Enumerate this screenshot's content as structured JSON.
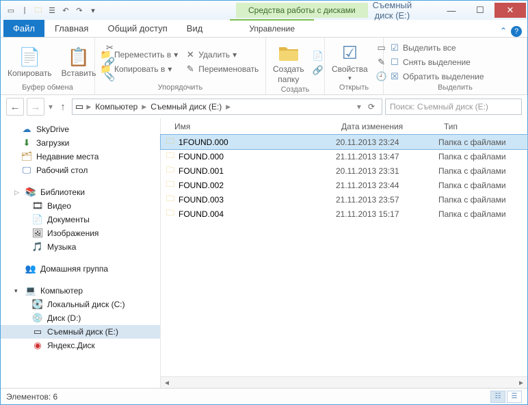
{
  "titlebar": {
    "context_tab": "Средства работы с дисками",
    "window_title": "Съемный диск (E:)"
  },
  "tabs": {
    "file": "Файл",
    "home": "Главная",
    "share": "Общий доступ",
    "view": "Вид",
    "manage": "Управление"
  },
  "ribbon": {
    "clipboard": {
      "copy": "Копировать",
      "paste": "Вставить",
      "label": "Буфер обмена"
    },
    "organize": {
      "moveto": "Переместить в",
      "copyto": "Копировать в",
      "delete": "Удалить",
      "rename": "Переименовать",
      "label": "Упорядочить"
    },
    "new": {
      "newfolder_l1": "Создать",
      "newfolder_l2": "папку",
      "label": "Создать"
    },
    "open": {
      "props": "Свойства",
      "label": "Открыть"
    },
    "select": {
      "all": "Выделить все",
      "none": "Снять выделение",
      "invert": "Обратить выделение",
      "label": "Выделить"
    }
  },
  "address": {
    "seg1": "Компьютер",
    "seg2": "Съемный диск (E:)"
  },
  "search": {
    "placeholder": "Поиск: Съемный диск (E:)"
  },
  "columns": {
    "name": "Имя",
    "date": "Дата изменения",
    "type": "Тип"
  },
  "files": [
    {
      "name": "1FOUND.000",
      "date": "20.11.2013 23:24",
      "type": "Папка с файлами"
    },
    {
      "name": "FOUND.000",
      "date": "21.11.2013 13:47",
      "type": "Папка с файлами"
    },
    {
      "name": "FOUND.001",
      "date": "20.11.2013 23:31",
      "type": "Папка с файлами"
    },
    {
      "name": "FOUND.002",
      "date": "21.11.2013 23:44",
      "type": "Папка с файлами"
    },
    {
      "name": "FOUND.003",
      "date": "21.11.2013 23:57",
      "type": "Папка с файлами"
    },
    {
      "name": "FOUND.004",
      "date": "21.11.2013 15:17",
      "type": "Папка с файлами"
    }
  ],
  "nav": {
    "skydrive": "SkyDrive",
    "downloads": "Загрузки",
    "recent": "Недавние места",
    "desktop": "Рабочий стол",
    "libraries": "Библиотеки",
    "videos": "Видео",
    "documents": "Документы",
    "pictures": "Изображения",
    "music": "Музыка",
    "homegroup": "Домашняя группа",
    "computer": "Компьютер",
    "localc": "Локальный диск (C:)",
    "diskd": "Диск (D:)",
    "remove": "Съемный диск (E:)",
    "yandex": "Яндекс.Диск"
  },
  "status": {
    "count": "Элементов: 6"
  }
}
